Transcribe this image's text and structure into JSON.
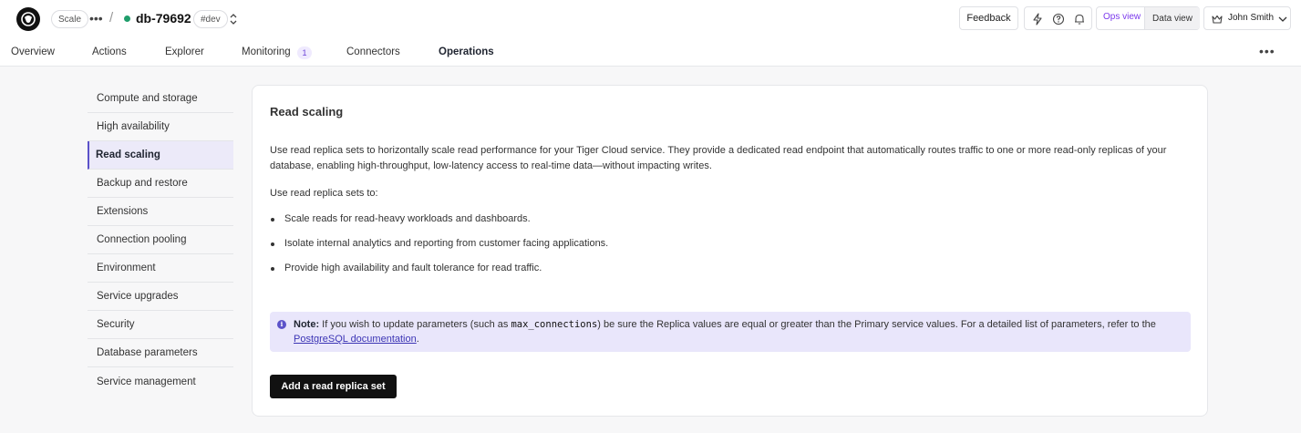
{
  "header": {
    "plan_badge": "Scale",
    "service_name": "db-79692",
    "env_tag": "#dev",
    "feedback_label": "Feedback",
    "ops_view_label": "Ops view",
    "data_view_label": "Data view",
    "user_name": "John Smith",
    "status_color": "#1f9d6b",
    "icons": [
      "logo-icon",
      "more-icon",
      "chevron-updown-icon",
      "lightning-icon",
      "help-icon",
      "bell-icon",
      "crown-icon",
      "chevron-down-icon"
    ]
  },
  "tabs": [
    {
      "label": "Overview"
    },
    {
      "label": "Actions"
    },
    {
      "label": "Explorer"
    },
    {
      "label": "Monitoring",
      "badge": "1"
    },
    {
      "label": "Connectors"
    },
    {
      "label": "Operations",
      "active": true
    }
  ],
  "sidebar": {
    "items": [
      {
        "label": "Compute and storage"
      },
      {
        "label": "High availability"
      },
      {
        "label": "Read scaling",
        "active": true
      },
      {
        "label": "Backup and restore"
      },
      {
        "label": "Extensions"
      },
      {
        "label": "Connection pooling"
      },
      {
        "label": "Environment"
      },
      {
        "label": "Service upgrades"
      },
      {
        "label": "Security"
      },
      {
        "label": "Database parameters"
      },
      {
        "label": "Service management"
      }
    ]
  },
  "main": {
    "title": "Read scaling",
    "description": "Use read replica sets to horizontally scale read performance for your Tiger Cloud service. They provide a dedicated read endpoint that automatically routes traffic to one or more read-only replicas of your database, enabling high-throughput, low-latency access to real-time data—without impacting writes.",
    "list_intro": "Use read replica sets to:",
    "bullets": [
      "Scale reads for read-heavy workloads and dashboards.",
      "Isolate internal analytics and reporting from customer facing applications.",
      "Provide high availability and fault tolerance for read traffic."
    ],
    "note": {
      "label": "Note:",
      "text_before": " If you wish to update parameters (such as ",
      "code": "max_connections",
      "text_after": ") be sure the Replica values are equal or greater than the Primary service values. For a detailed list of parameters, refer to the ",
      "link_text": "PostgreSQL documentation",
      "end": "."
    },
    "primary_button": "Add a read replica set"
  },
  "colors": {
    "accent": "#5b52c9",
    "note_bg": "#e9e6fb",
    "ops_view": "#7c3aed",
    "button_bg": "#111111"
  }
}
